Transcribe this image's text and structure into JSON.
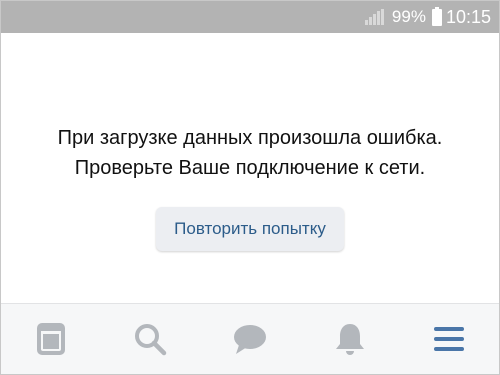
{
  "status_bar": {
    "battery_percent": "99%",
    "time": "10:15"
  },
  "error": {
    "line1": "При загрузке данных произошла ошибка.",
    "line2": "Проверьте Ваше подключение к сети."
  },
  "retry_button": {
    "label": "Повторить попытку"
  },
  "tabs": [
    {
      "icon": "news-icon",
      "active": false
    },
    {
      "icon": "search-icon",
      "active": false
    },
    {
      "icon": "messages-icon",
      "active": false
    },
    {
      "icon": "notifications-icon",
      "active": false
    },
    {
      "icon": "menu-icon",
      "active": true
    }
  ],
  "colors": {
    "status_bar": "#b3b3b3",
    "accent": "#2c5c8a",
    "tab_inactive": "#b3b7bc",
    "tab_active": "#4a76a8"
  }
}
